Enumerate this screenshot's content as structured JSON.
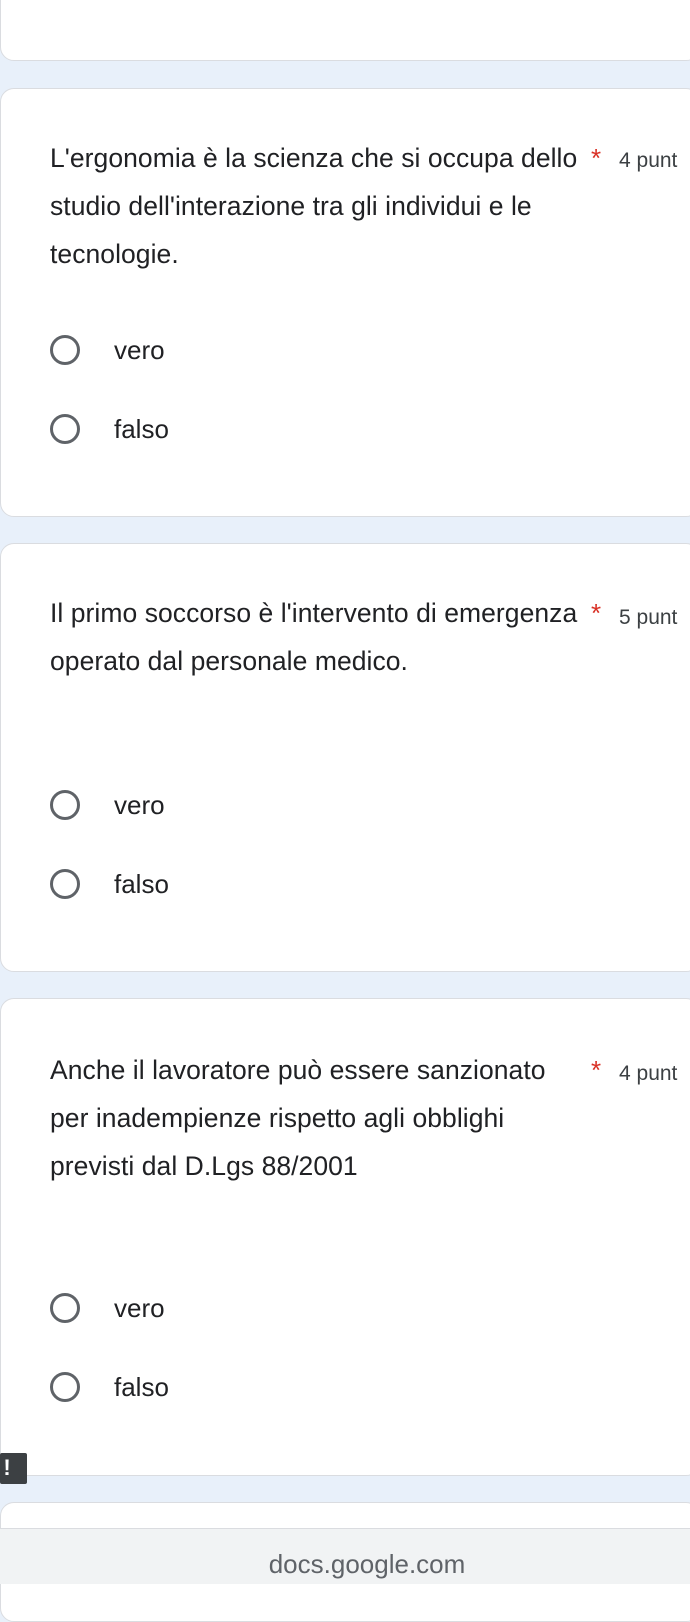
{
  "questions": [
    {
      "text": "L'ergonomia è la scienza che si occupa dello studio dell'interazione tra gli individui e le tecnologie.",
      "required_mark": "*",
      "points": "4 punt",
      "options": [
        "vero",
        "falso"
      ]
    },
    {
      "text": "Il primo soccorso è l'intervento di emergenza operato dal personale medico.",
      "required_mark": "*",
      "points": "5 punt",
      "options": [
        "vero",
        "falso"
      ]
    },
    {
      "text": "Anche il lavoratore può essere sanzionato per inadempienze rispetto agli obblighi previsti dal D.Lgs 88/2001",
      "required_mark": "*",
      "points": "4 punt",
      "options": [
        "vero",
        "falso"
      ]
    }
  ],
  "error_badge": "!",
  "browser": {
    "url": "docs.google.com"
  },
  "colors": {
    "background": "#e8f0fa",
    "card": "#ffffff",
    "required": "#d93025",
    "radio_border": "#5f6368"
  }
}
